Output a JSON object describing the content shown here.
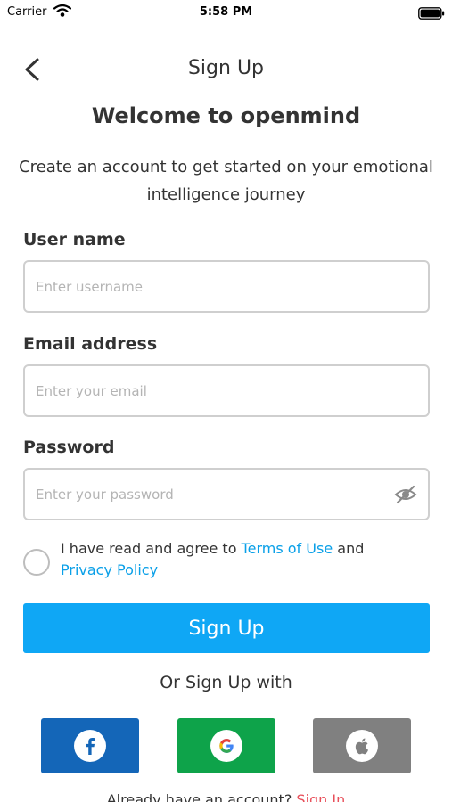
{
  "status_bar": {
    "carrier": "Carrier",
    "time": "5:58 PM"
  },
  "nav": {
    "title": "Sign Up"
  },
  "heading": "Welcome to openmind",
  "subtitle": "Create an account to get started on your emotional intelligence journey",
  "form": {
    "username": {
      "label": "User name",
      "placeholder": "Enter username"
    },
    "email": {
      "label": "Email address",
      "placeholder": "Enter your email"
    },
    "password": {
      "label": "Password",
      "placeholder": "Enter your password"
    }
  },
  "agree": {
    "prefix": "I have read and agree to ",
    "terms": "Terms of Use",
    "and": " and",
    "privacy": "Privacy Policy"
  },
  "signup_button": "Sign Up",
  "or_text": "Or Sign Up with",
  "social": [
    {
      "name": "facebook",
      "icon": "facebook-icon",
      "color": "#1466b8"
    },
    {
      "name": "google",
      "icon": "google-icon",
      "color": "#0ea34a"
    },
    {
      "name": "apple",
      "icon": "apple-icon",
      "color": "#808080"
    }
  ],
  "footer": {
    "text": "Already have an account? ",
    "link": "Sign In"
  },
  "colors": {
    "accent": "#0fa7f5",
    "link": "#0aa0e8",
    "text": "#333333"
  }
}
